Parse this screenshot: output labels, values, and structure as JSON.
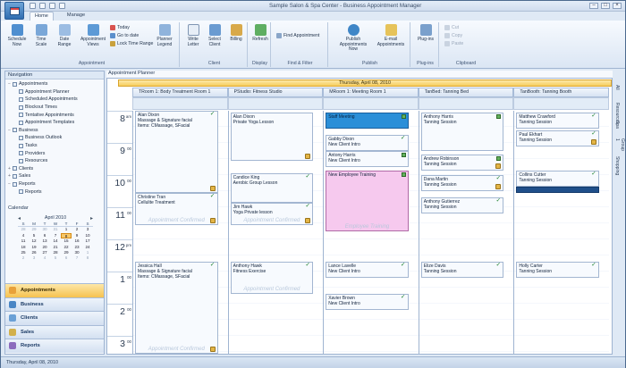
{
  "window": {
    "title": "Sample Salon & Spa Center - Business Appointment Manager",
    "controls": [
      "–",
      "□",
      "×"
    ]
  },
  "ribbon": {
    "tabs": [
      "Home",
      "Manage"
    ],
    "groups": [
      {
        "label": "Appointment",
        "buttons": [
          "Schedule Now",
          "Time Scale",
          "Date Range",
          "Appointment Views"
        ],
        "small": [
          "Today",
          "Go to date",
          "Lock Time Range"
        ]
      },
      {
        "label": "Client",
        "buttons": [
          "Planner Legend",
          "Write Letter",
          "Select Client",
          "Billing"
        ]
      },
      {
        "label": "Display",
        "buttons": [
          "Refresh"
        ]
      },
      {
        "label": "Find & Filter",
        "small": [
          "Find Appointment"
        ]
      },
      {
        "label": "Publish",
        "buttons": [
          "Publish Appointments Now",
          "E-mail Appointments"
        ]
      },
      {
        "label": "Plug-ins",
        "buttons": [
          "Plug-ins"
        ]
      },
      {
        "label": "Clipboard",
        "small": [
          "Cut",
          "Copy",
          "Paste"
        ]
      }
    ]
  },
  "nav": {
    "header": "Navigation",
    "tree": [
      {
        "label": "Appointments",
        "level": 0,
        "expander": "−"
      },
      {
        "label": "Appointment Planner",
        "level": 1
      },
      {
        "label": "Scheduled Appointments",
        "level": 1
      },
      {
        "label": "Blockout Times",
        "level": 1
      },
      {
        "label": "Tentative Appointments",
        "level": 1
      },
      {
        "label": "Appointment Templates",
        "level": 1
      },
      {
        "label": "Business",
        "level": 0,
        "expander": "−"
      },
      {
        "label": "Business Outlook",
        "level": 1
      },
      {
        "label": "Tasks",
        "level": 1
      },
      {
        "label": "Providers",
        "level": 1
      },
      {
        "label": "Resources",
        "level": 1
      },
      {
        "label": "Clients",
        "level": 0,
        "expander": "+"
      },
      {
        "label": "Sales",
        "level": 0,
        "expander": "+"
      },
      {
        "label": "Reports",
        "level": 0,
        "expander": "−"
      },
      {
        "label": "Reports",
        "level": 1
      }
    ],
    "calendar_label": "Calendar",
    "mini_cal": {
      "title": "April 2010",
      "dow": [
        "S",
        "M",
        "T",
        "W",
        "T",
        "F",
        "S"
      ],
      "weeks": [
        [
          "28",
          "29",
          "30",
          "31",
          "1",
          "2",
          "3"
        ],
        [
          "4",
          "5",
          "6",
          "7",
          "8",
          "9",
          "10"
        ],
        [
          "11",
          "12",
          "13",
          "14",
          "15",
          "16",
          "17"
        ],
        [
          "18",
          "19",
          "20",
          "21",
          "22",
          "23",
          "24"
        ],
        [
          "25",
          "26",
          "27",
          "28",
          "29",
          "30",
          "1"
        ],
        [
          "2",
          "3",
          "4",
          "5",
          "6",
          "7",
          "8"
        ]
      ],
      "today": "8"
    },
    "buttons": [
      "Appointments",
      "Business",
      "Clients",
      "Sales",
      "Reports"
    ]
  },
  "scheduler": {
    "title": "Appointment Planner",
    "date": "Thursday, April 08, 2010",
    "resources": [
      "TRoom 1: Body Treatment Room 1",
      "PStudio: Fitness Studio",
      "MRoom 1: Meeting Room 1",
      "TanBed: Tanning Bed",
      "TanBooth: Tanning Booth"
    ],
    "hours": [
      {
        "num": "8",
        "suf": "am"
      },
      {
        "num": "9",
        "suf": "00"
      },
      {
        "num": "10",
        "suf": "00"
      },
      {
        "num": "11",
        "suf": "00"
      },
      {
        "num": "12",
        "suf": "pm"
      },
      {
        "num": "1",
        "suf": "00"
      },
      {
        "num": "2",
        "suf": "00"
      },
      {
        "num": "3",
        "suf": "00"
      }
    ],
    "appointments": [
      {
        "col": 0,
        "start": 0.0,
        "end": 2.55,
        "name": "Alan Dixon",
        "desc": "Massage & Signature facial",
        "desc2": "Items: CMassage, SFacial",
        "style": "confirmed-blank",
        "check": true,
        "icon": true,
        "confirm_text": ""
      },
      {
        "col": 0,
        "start": 2.55,
        "end": 3.55,
        "name": "Christine Tran",
        "desc": "Cellulite Treatment",
        "style": "confirmed-blank",
        "check": true,
        "icon": true,
        "confirm_text": "Appointment Confirmed"
      },
      {
        "col": 0,
        "start": 4.7,
        "end": 7.55,
        "name": "Jessica Hall",
        "desc": "Massage & Signature facial",
        "desc2": "Items: CMassage, SFacial",
        "style": "confirmed-blank",
        "check": true,
        "icon": true,
        "confirm_text": "Appointment Confirmed"
      },
      {
        "col": 1,
        "start": 0.05,
        "end": 1.55,
        "name": "Alan Dixon",
        "desc": "Private Yoga Lesson",
        "style": "confirmed-blank",
        "check": false,
        "icon": true,
        "confirm_text": ""
      },
      {
        "col": 1,
        "start": 1.95,
        "end": 2.85,
        "name": "Candice King",
        "desc": "Aerobic Group Lesson",
        "style": "confirmed-blank",
        "check": true,
        "icon": false,
        "confirm_text": ""
      },
      {
        "col": 1,
        "start": 2.85,
        "end": 3.55,
        "name": "Jim Hawk",
        "desc": "Yoga Private lesson",
        "style": "confirmed-blank",
        "check": true,
        "icon": true,
        "confirm_text": "Appointment Confirmed"
      },
      {
        "col": 1,
        "start": 4.7,
        "end": 5.7,
        "name": "Anthony Hawk",
        "desc": "Fitness Exercise",
        "style": "confirmed-blank",
        "check": true,
        "icon": false,
        "confirm_text": "Appointment Confirmed"
      },
      {
        "col": 2,
        "start": 0.05,
        "end": 0.55,
        "name": "Staff Meeting",
        "desc": "",
        "style": "blue",
        "check": false,
        "icon": false,
        "gsq": true,
        "confirm_text": ""
      },
      {
        "col": 2,
        "start": 0.75,
        "end": 1.25,
        "name": "Gabby Dixon",
        "desc": "New Client Intro",
        "style": "confirmed-blank",
        "check": true,
        "icon": false,
        "confirm_text": ""
      },
      {
        "col": 2,
        "start": 1.25,
        "end": 1.75,
        "name": "Antony Harris",
        "desc": "New Client Intro",
        "style": "confirmed-blank",
        "check": false,
        "icon": false,
        "gsq": true,
        "confirm_text": ""
      },
      {
        "col": 2,
        "start": 1.85,
        "end": 3.75,
        "name": "New Employee Training",
        "desc": "",
        "style": "pink",
        "check": false,
        "icon": false,
        "gsq": true,
        "confirm_text": "Employee Training"
      },
      {
        "col": 2,
        "start": 4.7,
        "end": 5.2,
        "name": "Lance Lavelle",
        "desc": "New Client Intro",
        "style": "confirmed-blank",
        "check": true,
        "icon": false,
        "confirm_text": ""
      },
      {
        "col": 2,
        "start": 5.7,
        "end": 6.2,
        "name": "Xavier Brown",
        "desc": "New Client Intro",
        "style": "confirmed-blank",
        "check": true,
        "icon": false,
        "confirm_text": ""
      },
      {
        "col": 3,
        "start": 0.05,
        "end": 1.25,
        "name": "Anthony Harris",
        "desc": "Tanning Session",
        "style": "confirmed-blank",
        "check": false,
        "icon": false,
        "gsq": true,
        "confirm_text": ""
      },
      {
        "col": 3,
        "start": 1.35,
        "end": 1.85,
        "name": "Andrew Robinson",
        "desc": "Tanning Session",
        "style": "confirmed-blank",
        "check": false,
        "icon": true,
        "gsq": true,
        "confirm_text": ""
      },
      {
        "col": 3,
        "start": 2.0,
        "end": 2.5,
        "name": "Dana Martin",
        "desc": "Tanning Session",
        "style": "confirmed-blank",
        "check": true,
        "icon": true,
        "confirm_text": ""
      },
      {
        "col": 3,
        "start": 2.7,
        "end": 3.2,
        "name": "Anthony Gutierrez",
        "desc": "Tanning Session",
        "style": "confirmed-blank",
        "check": true,
        "icon": false,
        "confirm_text": ""
      },
      {
        "col": 3,
        "start": 4.7,
        "end": 5.2,
        "name": "Elize Davis",
        "desc": "Tanning Session",
        "style": "confirmed-blank",
        "check": true,
        "icon": false,
        "confirm_text": ""
      },
      {
        "col": 4,
        "start": 0.05,
        "end": 0.55,
        "name": "Matthew Crawford",
        "desc": "Tanning Session",
        "style": "confirmed-blank",
        "check": true,
        "icon": false,
        "confirm_text": ""
      },
      {
        "col": 4,
        "start": 0.6,
        "end": 1.1,
        "name": "Paul Ekhart",
        "desc": "Tanning Session",
        "style": "confirmed-blank",
        "check": true,
        "icon": true,
        "confirm_text": ""
      },
      {
        "col": 4,
        "start": 1.85,
        "end": 2.35,
        "name": "Collins Cutter",
        "desc": "Tanning Session",
        "style": "confirmed-blank",
        "check": true,
        "icon": false,
        "confirm_text": ""
      },
      {
        "col": 4,
        "start": 2.35,
        "end": 2.55,
        "name": "",
        "desc": "",
        "style": "dark",
        "check": false,
        "icon": false,
        "confirm_text": ""
      },
      {
        "col": 4,
        "start": 4.7,
        "end": 5.2,
        "name": "Holly Carter",
        "desc": "Tanning Session",
        "style": "confirmed-blank",
        "check": true,
        "icon": false,
        "confirm_text": ""
      }
    ]
  },
  "right_tabs": [
    "All",
    "Resources",
    "Spa",
    "Group 1",
    "Shopping"
  ],
  "status": {
    "text": "Thursday, April 08, 2010"
  }
}
